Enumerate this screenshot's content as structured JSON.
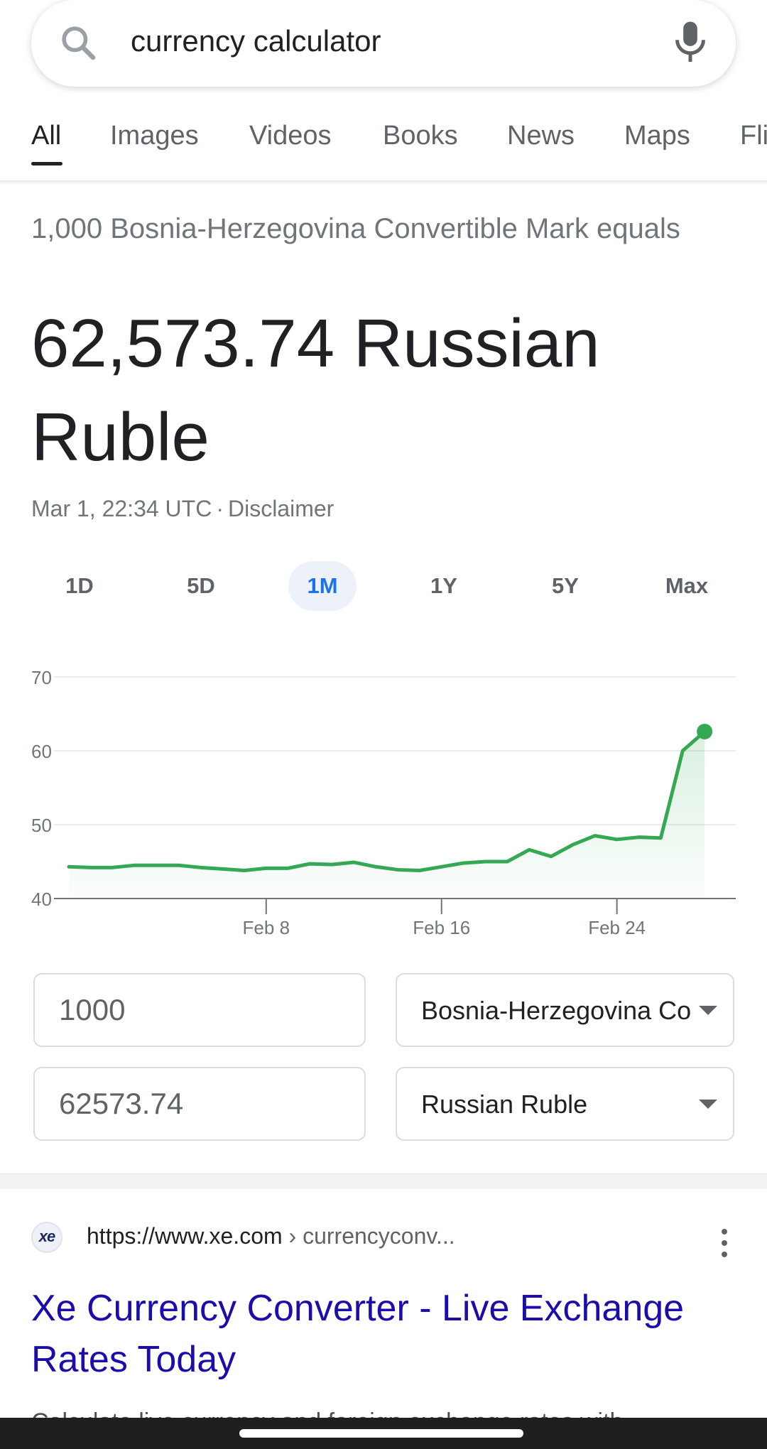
{
  "search": {
    "query": "currency calculator",
    "icons": {
      "search": "search-icon",
      "mic": "microphone-icon"
    }
  },
  "tabs": [
    {
      "label": "All",
      "active": true
    },
    {
      "label": "Images",
      "active": false
    },
    {
      "label": "Videos",
      "active": false
    },
    {
      "label": "Books",
      "active": false
    },
    {
      "label": "News",
      "active": false
    },
    {
      "label": "Maps",
      "active": false
    },
    {
      "label": "Fli",
      "active": false
    }
  ],
  "converter": {
    "from_line": "1,000 Bosnia-Herzegovina Convertible Mark equals",
    "result": "62,573.74 Russian Ruble",
    "timestamp": "Mar 1, 22:34 UTC",
    "separator": "·",
    "disclaimer": "Disclaimer",
    "ranges": [
      {
        "label": "1D",
        "active": false
      },
      {
        "label": "5D",
        "active": false
      },
      {
        "label": "1M",
        "active": true
      },
      {
        "label": "1Y",
        "active": false
      },
      {
        "label": "5Y",
        "active": false
      },
      {
        "label": "Max",
        "active": false
      }
    ],
    "from_amount": "1000",
    "from_currency": "Bosnia-Herzegovina Convertible Mark",
    "to_amount": "62573.74",
    "to_currency": "Russian Ruble"
  },
  "chart_data": {
    "type": "area",
    "x": [
      "Jan 30",
      "Jan 31",
      "Feb 1",
      "Feb 2",
      "Feb 3",
      "Feb 4",
      "Feb 5",
      "Feb 6",
      "Feb 7",
      "Feb 8",
      "Feb 9",
      "Feb 10",
      "Feb 11",
      "Feb 12",
      "Feb 13",
      "Feb 14",
      "Feb 15",
      "Feb 16",
      "Feb 17",
      "Feb 18",
      "Feb 19",
      "Feb 20",
      "Feb 21",
      "Feb 22",
      "Feb 23",
      "Feb 24",
      "Feb 25",
      "Feb 26",
      "Feb 27",
      "Feb 28",
      "Mar 1"
    ],
    "series": [
      {
        "values": [
          44.3,
          44.2,
          44.2,
          44.5,
          44.5,
          44.5,
          44.2,
          44.0,
          43.8,
          44.1,
          44.1,
          44.7,
          44.6,
          44.9,
          44.3,
          43.9,
          43.8,
          44.3,
          44.8,
          45.0,
          45.0,
          46.6,
          45.7,
          47.3,
          48.5,
          48.0,
          48.3,
          48.2,
          60.0,
          62.6
        ]
      }
    ],
    "x_ticks": [
      "Feb 8",
      "Feb 16",
      "Feb 24"
    ],
    "y_ticks": [
      40,
      50,
      60,
      70
    ],
    "ylim": [
      40,
      70
    ],
    "grid": true,
    "color": "#34a853"
  },
  "result_card": {
    "favicon_text": "xe",
    "url": "https://www.xe.com",
    "breadcrumb": " › currencyconv...",
    "title": "Xe Currency Converter - Live Exchange Rates Today",
    "snippet": "Calculate live currency and foreign exchange rates with"
  },
  "colors": {
    "accent": "#1a73e8",
    "link": "#1a0dab",
    "chart_line": "#34a853"
  }
}
